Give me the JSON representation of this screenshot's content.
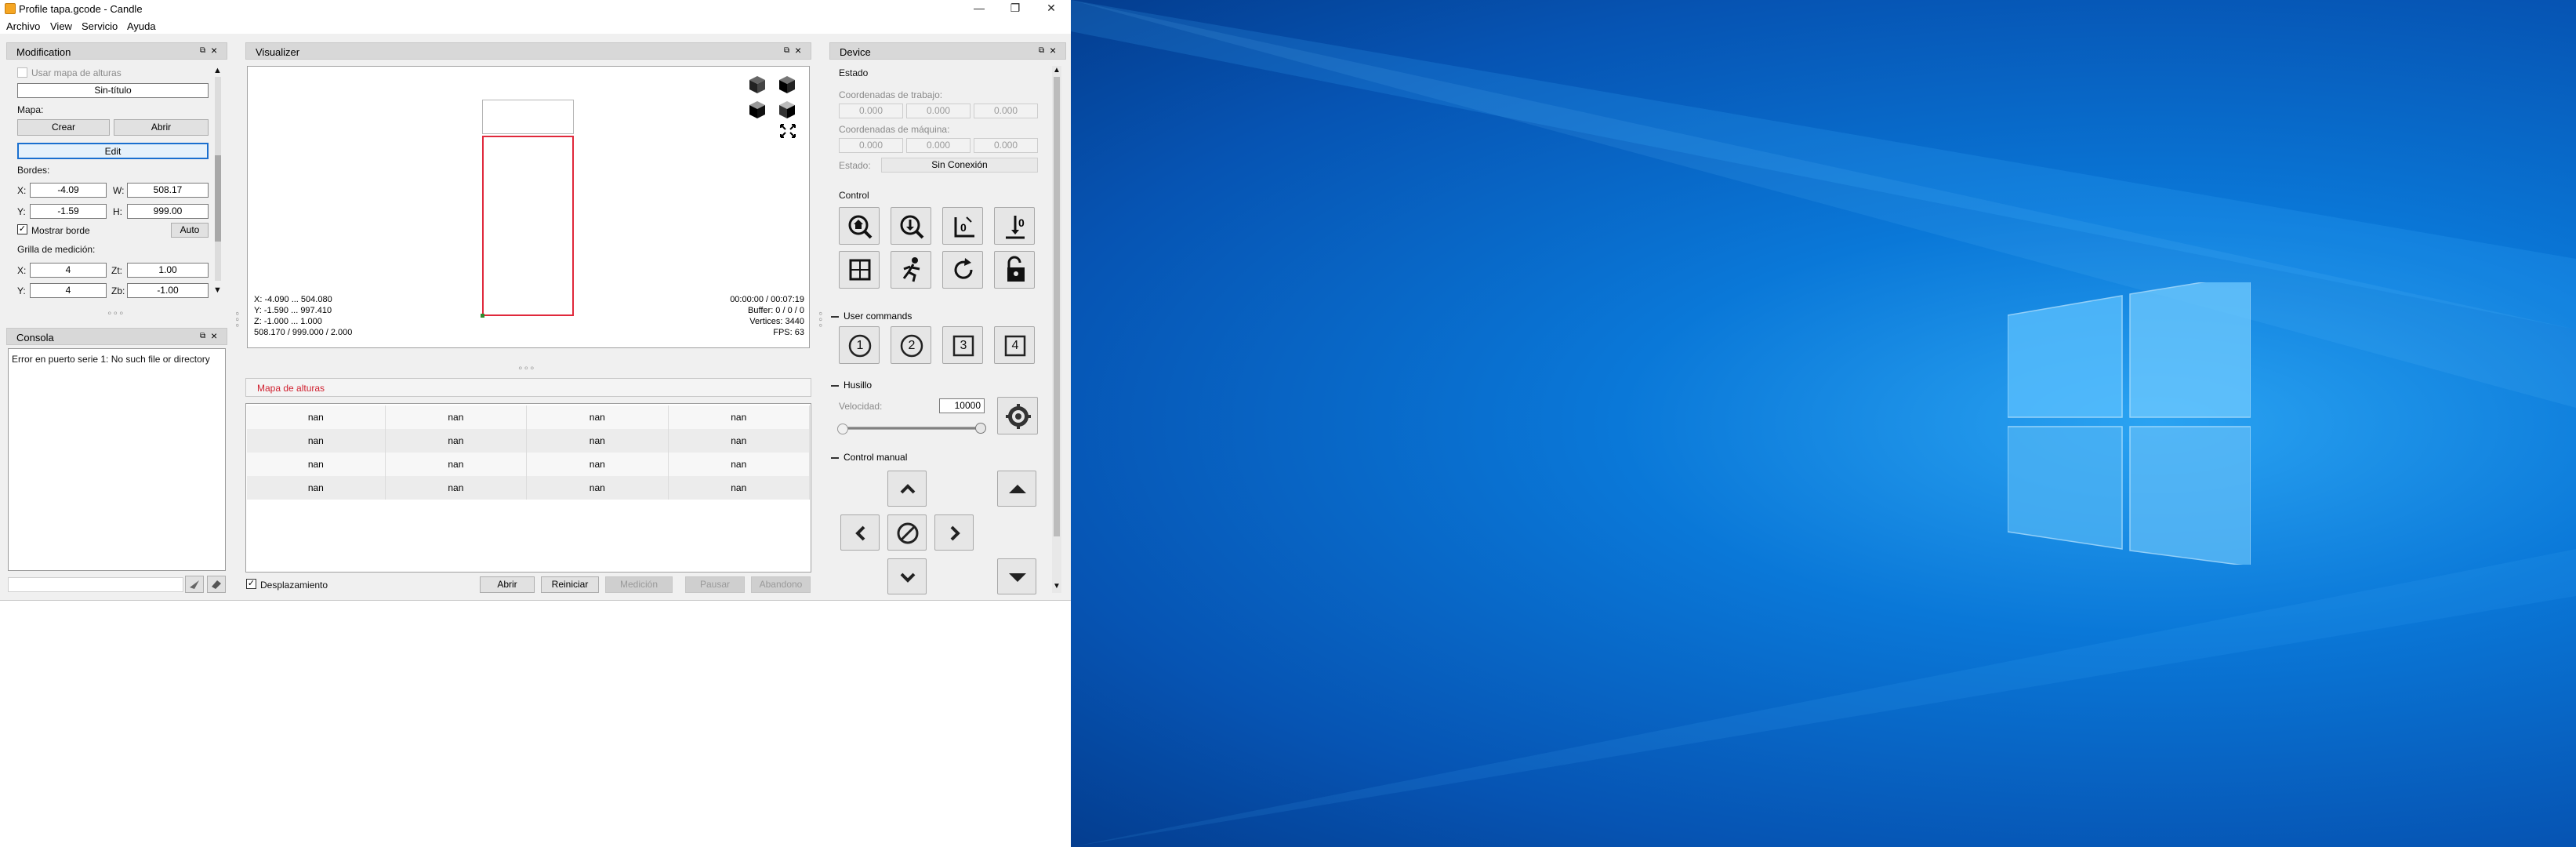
{
  "window": {
    "title": "Profile tapa.gcode - Candle",
    "minimize": "—",
    "restore": "❐",
    "close": "✕"
  },
  "menu": [
    "Archivo",
    "View",
    "Servicio",
    "Ayuda"
  ],
  "modification": {
    "title": "Modification",
    "use_heightmap": "Usar mapa de alturas",
    "name_value": "Sin-título",
    "map_label": "Mapa:",
    "create": "Crear",
    "open": "Abrir",
    "edit": "Edit",
    "borders_label": "Bordes:",
    "x_label": "X:",
    "x_value": "-4.09",
    "w_label": "W:",
    "w_value": "508.17",
    "y_label": "Y:",
    "y_value": "-1.59",
    "h_label": "H:",
    "h_value": "999.00",
    "show_border": "Mostrar borde",
    "auto": "Auto",
    "grid_label": "Grilla de medición:",
    "gx_label": "X:",
    "gx_value": "4",
    "zt_label": "Zt:",
    "zt_value": "1.00",
    "gy_label": "Y:",
    "gy_value": "4",
    "zb_label": "Zb:",
    "zb_value": "-1.00"
  },
  "console": {
    "title": "Consola",
    "message": "Error en puerto serie 1: No such file or directory"
  },
  "visualizer": {
    "title": "Visualizer",
    "info_left": [
      "X: -4.090 ... 504.080",
      "Y: -1.590 ... 997.410",
      "Z: -1.000 ... 1.000",
      "508.170 / 999.000 / 2.000"
    ],
    "info_right": [
      "00:00:00 / 00:07:19",
      "Buffer: 0 / 0 / 0",
      "Vertices: 3440",
      "FPS: 63"
    ]
  },
  "heightmap": {
    "title": "Mapa de alturas",
    "rows": [
      [
        "nan",
        "nan",
        "nan",
        "nan"
      ],
      [
        "nan",
        "nan",
        "nan",
        "nan"
      ],
      [
        "nan",
        "nan",
        "nan",
        "nan"
      ],
      [
        "nan",
        "nan",
        "nan",
        "nan"
      ]
    ],
    "scroll_label": "Desplazamiento",
    "buttons": {
      "open": "Abrir",
      "reset": "Reiniciar",
      "probe": "Medición",
      "pause": "Pausar",
      "abort": "Abandono"
    }
  },
  "device": {
    "title": "Device",
    "state_section": "Estado",
    "work_coords_label": "Coordenadas de trabajo:",
    "work_coords": [
      "0.000",
      "0.000",
      "0.000"
    ],
    "machine_coords_label": "Coordenadas de máquina:",
    "machine_coords": [
      "0.000",
      "0.000",
      "0.000"
    ],
    "status_label": "Estado:",
    "status_value": "Sin Conexión",
    "control_section": "Control",
    "user_commands_section": "User commands",
    "user_commands": [
      "1",
      "2",
      "3",
      "4"
    ],
    "spindle_section": "Husillo",
    "speed_label": "Velocidad:",
    "speed_value": "10000",
    "speed_level": 1.0,
    "manual_section": "Control manual"
  },
  "colors": {
    "accent": "#0a78d8",
    "toolpath": "#e0283b",
    "heightmap_title": "#d01f2e"
  }
}
